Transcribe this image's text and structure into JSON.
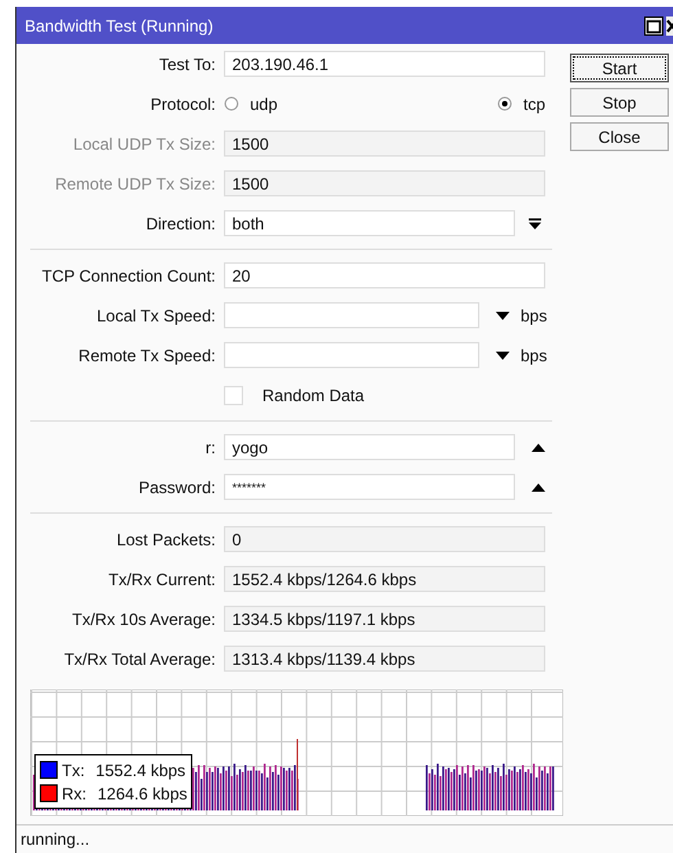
{
  "window": {
    "title": "Bandwidth Test (Running)"
  },
  "sections": [
    [
      {
        "kind": "text",
        "label": "Test To:",
        "value": "203.190.46.1",
        "disabled": false
      },
      {
        "kind": "radio",
        "label": "Protocol:",
        "options": [
          {
            "label": "udp",
            "selected": false
          },
          {
            "label": "tcp",
            "selected": true
          }
        ]
      },
      {
        "kind": "text",
        "label": "Local UDP Tx Size:",
        "value": "1500",
        "disabled": true
      },
      {
        "kind": "text",
        "label": "Remote UDP Tx Size:",
        "value": "1500",
        "disabled": true
      },
      {
        "kind": "select",
        "label": "Direction:",
        "value": "both"
      }
    ],
    [
      {
        "kind": "text",
        "label": "TCP Connection Count:",
        "value": "20",
        "disabled": false
      },
      {
        "kind": "speed",
        "label": "Local Tx Speed:",
        "unit": "bps"
      },
      {
        "kind": "speed",
        "label": "Remote Tx Speed:",
        "unit": "bps"
      },
      {
        "kind": "checkbox",
        "label": "Random Data",
        "checked": false
      }
    ],
    [
      {
        "kind": "collapse",
        "label": "r:",
        "value": "yogo"
      },
      {
        "kind": "collapse",
        "label": "Password:",
        "value": "*******"
      }
    ],
    [
      {
        "kind": "stat",
        "label": "Lost Packets:",
        "value": "0"
      },
      {
        "kind": "stat",
        "label": "Tx/Rx Current:",
        "value": "1552.4 kbps/1264.6 kbps"
      },
      {
        "kind": "stat",
        "label": "Tx/Rx 10s Average:",
        "value": "1334.5 kbps/1197.1 kbps"
      },
      {
        "kind": "stat",
        "label": "Tx/Rx Total Average:",
        "value": "1313.4 kbps/1139.4 kbps"
      }
    ]
  ],
  "legend": [
    {
      "label": "Tx:",
      "value": "1552.4 kbps",
      "color": "#0000ff"
    },
    {
      "label": "Rx:",
      "value": "1264.6 kbps",
      "color": "#ff0000"
    }
  ],
  "buttons": [
    {
      "label": "Start",
      "focused": true
    },
    {
      "label": "Stop",
      "focused": false
    },
    {
      "label": "Close",
      "focused": false
    }
  ],
  "status": "running..."
}
